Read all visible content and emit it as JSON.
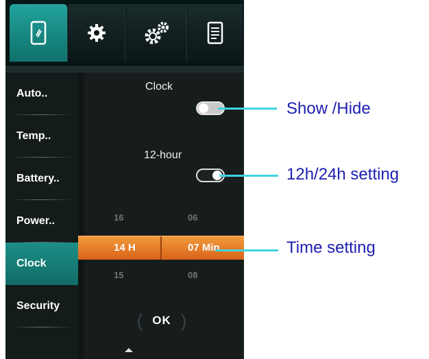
{
  "tabs": [
    {
      "icon": "phone-icon"
    },
    {
      "icon": "gear-icon"
    },
    {
      "icon": "gears-icon"
    },
    {
      "icon": "document-icon"
    }
  ],
  "sidebar": {
    "items": [
      {
        "label": "Auto.."
      },
      {
        "label": "Temp.."
      },
      {
        "label": "Battery.."
      },
      {
        "label": "Power.."
      },
      {
        "label": "Clock"
      },
      {
        "label": "Security"
      }
    ]
  },
  "content": {
    "clock_label": "Clock",
    "hour_label": "12-hour",
    "time_picker": {
      "hour_prev": "16",
      "minute_prev": "06",
      "hour_selected": "14 H",
      "minute_selected": "07 Min",
      "hour_next": "15",
      "minute_next": "08"
    },
    "ok_label": "OK"
  },
  "annotations": {
    "show_hide": "Show /Hide",
    "format": "12h/24h setting",
    "time": "Time setting"
  },
  "colors": {
    "accent": "#1c8e87",
    "time_bar": "#e07a26",
    "callout_line": "#3fd5e0",
    "callout_text": "#1c1fb0"
  }
}
